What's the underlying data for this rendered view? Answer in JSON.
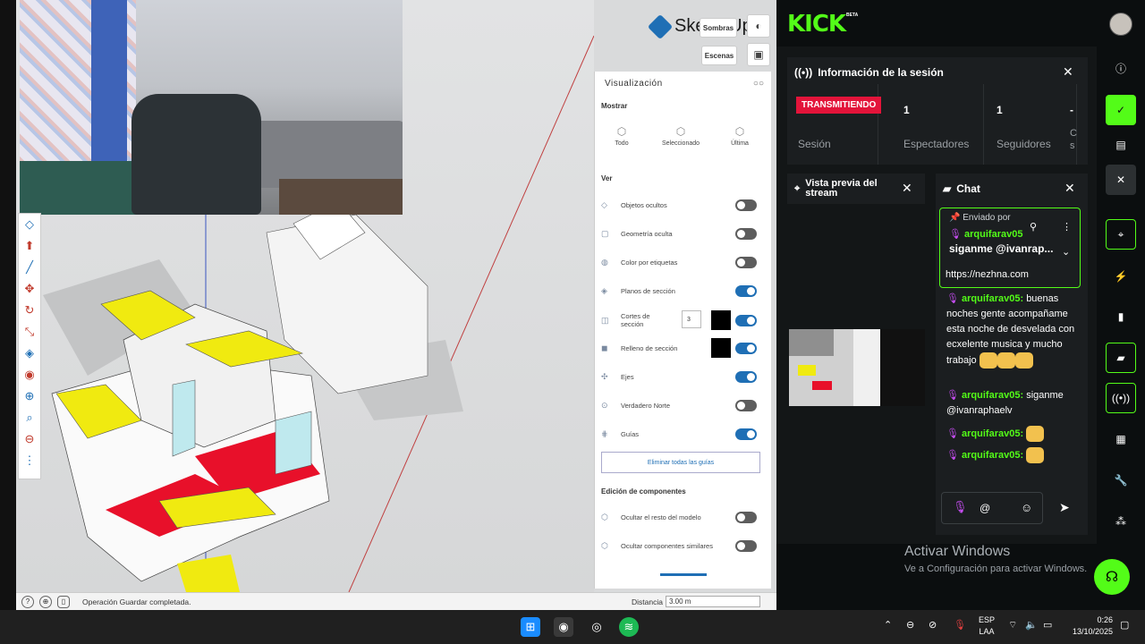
{
  "sketchup": {
    "logo_text": "SketchUp",
    "buttons": {
      "shadows": "Sombras",
      "scenes": "Escenas"
    },
    "panel": {
      "title": "Visualización",
      "show_section": "Mostrar",
      "show_options": [
        "Todo",
        "Seleccionado",
        "Última"
      ],
      "view_section": "Ver",
      "rows": [
        {
          "label": "Objetos ocultos",
          "on": false
        },
        {
          "label": "Geometría oculta",
          "on": false
        },
        {
          "label": "Color por etiquetas",
          "on": false
        },
        {
          "label": "Planos de sección",
          "on": true
        },
        {
          "label": "Cortes de sección",
          "on": true,
          "value": "3"
        },
        {
          "label": "Relleno de sección",
          "on": true
        },
        {
          "label": "Ejes",
          "on": true
        },
        {
          "label": "Verdadero Norte",
          "on": false
        },
        {
          "label": "Guías",
          "on": true
        }
      ],
      "delete_guides": "Eliminar todas las guías",
      "components_section": "Edición de componentes",
      "component_rows": [
        {
          "label": "Ocultar el resto del modelo",
          "on": false
        },
        {
          "label": "Ocultar componentes similares",
          "on": false
        }
      ]
    },
    "status": {
      "message": "Operación Guardar completada.",
      "distance_label": "Distancia",
      "distance_value": "3.00 m"
    }
  },
  "kick": {
    "logo": "KICK",
    "beta": "BETA",
    "session": {
      "title": "Información de la sesión",
      "badge": "TRANSMITIENDO",
      "stats": [
        {
          "num": "",
          "label": "Sesión"
        },
        {
          "num": "1",
          "label": "Espectadores"
        },
        {
          "num": "1",
          "label": "Seguidores"
        },
        {
          "num": "-",
          "label": "C s"
        }
      ]
    },
    "preview": {
      "title": "Vista previa del stream"
    },
    "chat": {
      "title": "Chat",
      "pinned_label": "Enviado por",
      "pinned_user": "arquifarav05",
      "pinned_text": "siganme @ivanrap...",
      "link": "https://nezhna.com",
      "messages": [
        {
          "user": "arquifarav05:",
          "text": "buenas noches gente acompañame esta noche de desvelada con ecxelente musica y mucho trabajo"
        },
        {
          "user": "arquifarav05:",
          "text": "siganme @ivanraphaelv"
        },
        {
          "user": "arquifarav05:",
          "text": ""
        },
        {
          "user": "arquifarav05:",
          "text": ""
        }
      ],
      "input_at": "@"
    },
    "activate": {
      "line1": "Activar Windows",
      "line2": "Ve a Configuración para activar Windows."
    }
  },
  "taskbar": {
    "lang1": "ESP",
    "lang2": "LAA",
    "time": "0:26",
    "date": "13/10/2025"
  },
  "colors": {
    "kick_green": "#53fc18",
    "live_red": "#e3143a",
    "sketch_blue": "#1f6fb5"
  }
}
